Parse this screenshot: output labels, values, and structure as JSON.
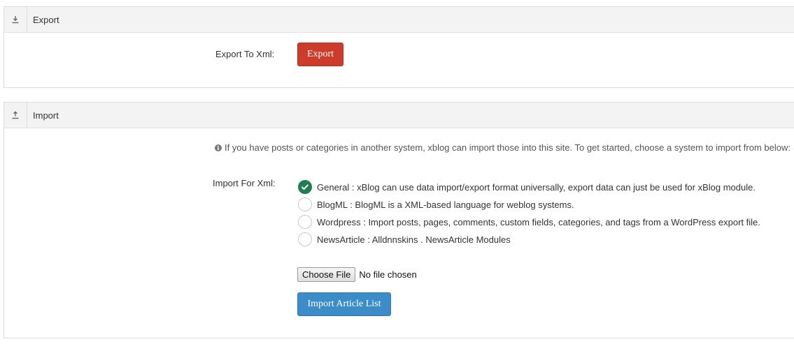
{
  "export_panel": {
    "title": "Export",
    "icon": "download-icon",
    "field_label": "Export To Xml:",
    "button_label": "Export"
  },
  "import_panel": {
    "title": "Import",
    "icon": "upload-icon",
    "info_text": "If you have posts or categories in another system, xblog can import those into this site. To get started, choose a system to import from below:",
    "field_label": "Import For Xml:",
    "options": [
      {
        "label": "General : xBlog can use data import/export format universally, export data can just be used for xBlog module.",
        "checked": true
      },
      {
        "label": "BlogML : BlogML is a XML-based language for weblog systems.",
        "checked": false
      },
      {
        "label": "Wordpress : Import posts, pages, comments, custom fields, categories, and tags from a WordPress export file.",
        "checked": false
      },
      {
        "label": "NewsArticle : Alldnnskins . NewsArticle Modules",
        "checked": false
      }
    ],
    "file_button": "Choose File",
    "file_status": "No file chosen",
    "submit_label": "Import Article List"
  },
  "colors": {
    "export_button": "#cd3b2b",
    "import_button": "#3d8cca",
    "radio_checked": "#1e7e52"
  }
}
